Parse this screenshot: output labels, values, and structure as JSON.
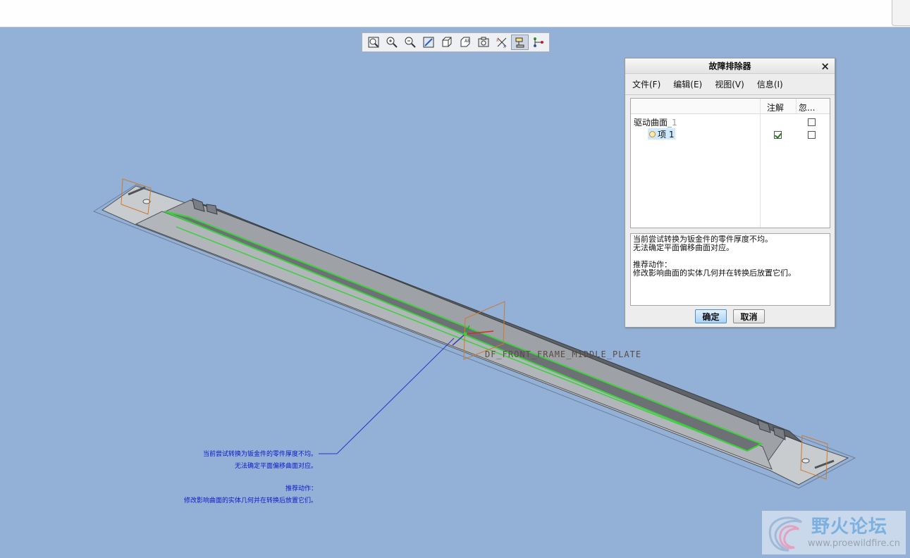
{
  "toolbar": {
    "buttons": [
      {
        "name": "refit-view-icon",
        "active": false
      },
      {
        "name": "zoom-in-icon",
        "active": false
      },
      {
        "name": "zoom-out-icon",
        "active": false
      },
      {
        "name": "repaint-icon",
        "active": false
      },
      {
        "name": "shading-style-icon",
        "active": false
      },
      {
        "name": "saved-views-icon",
        "active": false
      },
      {
        "name": "view-manager-icon",
        "active": false
      },
      {
        "name": "datum-display-icon",
        "active": false
      },
      {
        "name": "annotation-display-icon",
        "active": true
      },
      {
        "name": "spin-center-icon",
        "active": false
      }
    ]
  },
  "model": {
    "label": "DF_FRONT_FRAME_MIDDLE_PLATE",
    "note_lines": [
      "当前尝试转换为钣金件的零件厚度不均。",
      "无法确定平面偏移曲面对应。"
    ],
    "note_action_title": "推荐动作：",
    "note_action_text": "修改影响曲面的实体几何并在转换后放置它们。"
  },
  "troubleshooter": {
    "title": "故障排除器",
    "menu": [
      "文件(F)",
      "编辑(E)",
      "视图(V)",
      "信息(I)"
    ],
    "columns": {
      "annotate": "注解",
      "ignore": "忽..."
    },
    "drive_surface": {
      "label": "驱动曲面",
      "suffix": "_1",
      "ignored": false
    },
    "item": {
      "label": "项 1",
      "annotated": true,
      "ignored": false
    },
    "message": {
      "line1": "当前尝试转换为钣金件的零件厚度不均。",
      "line2": "无法确定平面偏移曲面对应。",
      "action_title": "推荐动作：",
      "action_text": "修改影响曲面的实体几何并在转换后放置它们。"
    },
    "ok_label": "确定",
    "cancel_label": "取消"
  },
  "watermark": {
    "title": "野火论坛",
    "url": "www.proewildfire.cn"
  }
}
